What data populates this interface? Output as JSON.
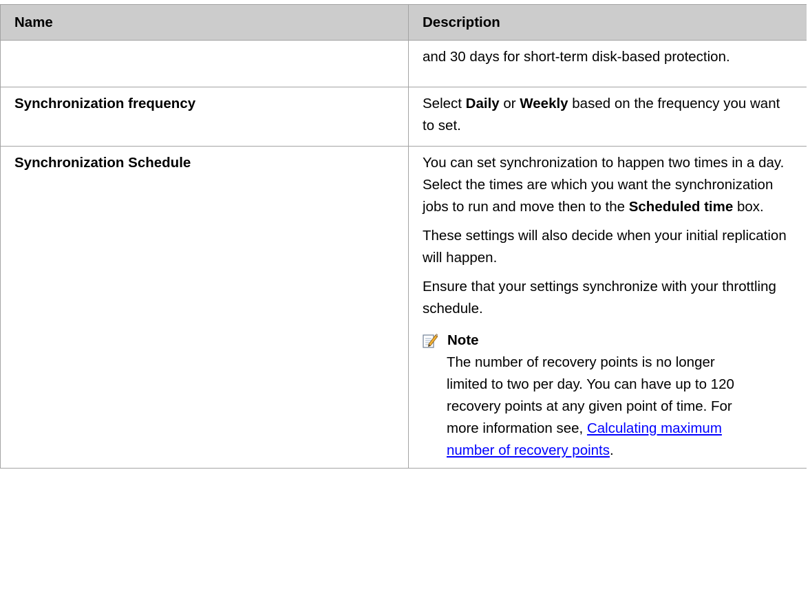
{
  "table": {
    "headers": {
      "name": "Name",
      "description": "Description"
    },
    "rows": [
      {
        "name": "",
        "description": "and 30 days for short-term disk-based protection."
      },
      {
        "name": "Synchronization frequency",
        "description": {
          "t1": "Select ",
          "b1": "Daily",
          "t2": " or ",
          "b2": "Weekly",
          "t3": " based on the frequency you want to set."
        }
      },
      {
        "name": "Synchronization Schedule",
        "description": {
          "p1": {
            "t1": "You can set synchronization to happen two times in a day. Select the times are which you want the synchronization jobs to run and move then to the ",
            "b1": "Scheduled time",
            "t2": " box."
          },
          "p2": "These settings will also decide when your initial replication will happen.",
          "p3": "Ensure that your settings synchronize with your throttling schedule.",
          "note": {
            "icon": "note-pencil-icon",
            "title": "Note",
            "text": "The number of recovery points is no longer limited to two per day. You can have up to 120 recovery points at any given point of time. For more information see, ",
            "link": "Calculating maximum number of recovery points",
            "after": "."
          }
        }
      }
    ]
  }
}
